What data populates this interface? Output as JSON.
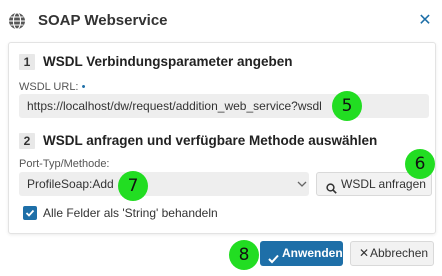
{
  "dialog": {
    "title": "SOAP Webservice",
    "close_icon": "close-icon",
    "header_icon": "globe-icon"
  },
  "section1": {
    "number": "1",
    "title": "WSDL Verbindungsparameter angeben",
    "url_label": "WSDL URL:",
    "required_marker": "•",
    "url_value": "https://localhost/dw/request/addition_web_service?wsdl"
  },
  "section2": {
    "number": "2",
    "title": "WSDL anfragen und verfügbare Methode auswählen",
    "method_label": "Port-Typ/Methode:",
    "method_value": "ProfileSoap:Add",
    "request_button": "WSDL anfragen",
    "checkbox_label": "Alle Felder als 'String' behandeln",
    "checkbox_checked": true
  },
  "footer": {
    "apply_button": "Anwenden",
    "cancel_button": "Abbrechen"
  },
  "markers": {
    "m5": "5",
    "m6": "6",
    "m7": "7",
    "m8": "8"
  },
  "colors": {
    "accent": "#1e6fa8",
    "marker": "#22dd22",
    "input_bg": "#eeeeee"
  }
}
